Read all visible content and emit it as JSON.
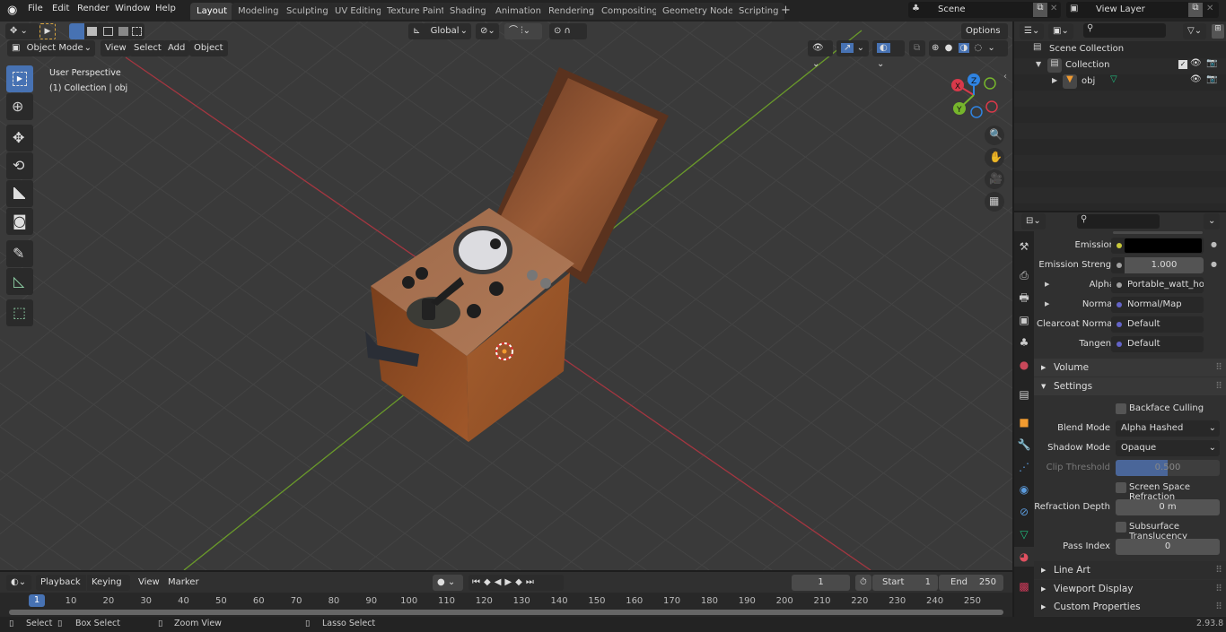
{
  "app": {
    "version": "2.93.8"
  },
  "topbar": {
    "menus": [
      "File",
      "Edit",
      "Render",
      "Window",
      "Help"
    ],
    "workspaces": [
      "Layout",
      "Modeling",
      "Sculpting",
      "UV Editing",
      "Texture Paint",
      "Shading",
      "Animation",
      "Rendering",
      "Compositing",
      "Geometry Nodes",
      "Scripting"
    ],
    "active_workspace": "Layout",
    "add_workspace": "+",
    "scene": "Scene",
    "view_layer": "View Layer"
  },
  "viewport": {
    "mode": "Object Mode",
    "menus": [
      "View",
      "Select",
      "Add",
      "Object"
    ],
    "transform_orientation": "Global",
    "options_label": "Options",
    "overlay_title": "User Perspective",
    "overlay_subtitle": "(1) Collection | obj",
    "gizmo": {
      "x": "X",
      "y": "Y",
      "z": "Z"
    },
    "colors": {
      "x_axis": "#d9394a",
      "y_axis": "#76b52c",
      "z_axis": "#2f84e3",
      "active": "#4772b3"
    },
    "tools": [
      "select-box",
      "cursor",
      "move",
      "rotate",
      "scale",
      "transform",
      "annotate",
      "measure",
      "add-cube"
    ]
  },
  "outliner": {
    "search_placeholder": "",
    "items": [
      {
        "label": "Scene Collection",
        "level": 0
      },
      {
        "label": "Collection",
        "level": 1,
        "checked": true
      },
      {
        "label": "obj",
        "level": 2
      }
    ]
  },
  "properties": {
    "search_placeholder": "",
    "rows": [
      {
        "label": "Emission",
        "value": "",
        "dot": "#c8c83a",
        "type": "color"
      },
      {
        "label": "Emission Strengt",
        "value": "1.000",
        "dot": "#a0a0a0",
        "type": "number"
      },
      {
        "label": "Alpha",
        "value": "Portable_watt_hourt...",
        "dot": "#a0a0a0",
        "type": "link"
      },
      {
        "label": "Normal",
        "value": "Normal/Map",
        "dot": "#6363c7",
        "type": "link"
      },
      {
        "label": "Clearcoat Normal",
        "value": "Default",
        "dot": "#6363c7",
        "type": "link"
      },
      {
        "label": "Tangent",
        "value": "Default",
        "dot": "#6363c7",
        "type": "link"
      }
    ],
    "sections": {
      "volume": "Volume",
      "settings": "Settings",
      "line_art": "Line Art",
      "viewport_display": "Viewport Display",
      "custom_properties": "Custom Properties"
    },
    "settings": {
      "backface_culling": {
        "label": "Backface Culling",
        "checked": false
      },
      "blend_mode": {
        "label": "Blend Mode",
        "value": "Alpha Hashed"
      },
      "shadow_mode": {
        "label": "Shadow Mode",
        "value": "Opaque"
      },
      "clip_threshold": {
        "label": "Clip Threshold",
        "value": "0.500",
        "fraction": 0.5
      },
      "screen_space_refraction": {
        "label": "Screen Space Refraction",
        "checked": false
      },
      "refraction_depth": {
        "label": "Refraction Depth",
        "value": "0 m"
      },
      "subsurface_translucency": {
        "label": "Subsurface Translucency",
        "checked": false
      },
      "pass_index": {
        "label": "Pass Index",
        "value": "0"
      }
    }
  },
  "timeline": {
    "menus": [
      "Playback",
      "Keying",
      "View",
      "Marker"
    ],
    "current_frame": "1",
    "start_label": "Start",
    "start": "1",
    "end_label": "End",
    "end": "250",
    "ticks": [
      "10",
      "20",
      "30",
      "40",
      "50",
      "60",
      "70",
      "80",
      "90",
      "100",
      "110",
      "120",
      "130",
      "140",
      "150",
      "160",
      "170",
      "180",
      "190",
      "200",
      "210",
      "220",
      "230",
      "240",
      "250"
    ]
  },
  "statusbar": {
    "items": [
      "Select",
      "Box Select",
      "Zoom View",
      "Lasso Select"
    ]
  }
}
